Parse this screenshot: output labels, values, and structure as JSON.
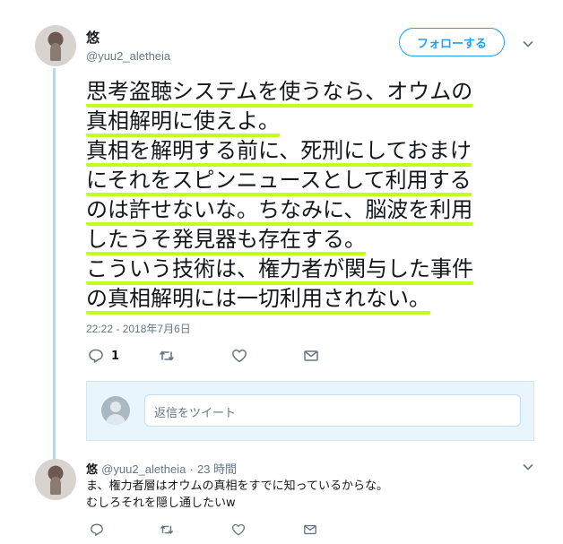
{
  "tweet": {
    "author_name": "悠",
    "author_handle": "@yuu2_aletheia",
    "follow_label": "フォローする",
    "lines": [
      "思考盗聴システムを使うなら、オウムの",
      "真相解明に使えよ。",
      "真相を解明する前に、死刑にしておまけ",
      "にそれをスピンニュースとして利用する",
      "のは許せないな。ちなみに、脳波を利用",
      "したうそ発見器も存在する。",
      "こういう技術は、権力者が関与した事件",
      "の真相解明には一切利用されない。"
    ],
    "timestamp": "22:22 - 2018年7月6日",
    "reply_count": "1"
  },
  "reply_box": {
    "placeholder": "返信をツイート"
  },
  "reply": {
    "author_name": "悠",
    "author_handle": "@yuu2_aletheia",
    "separator": "·",
    "time_ago": "23 時間",
    "lines": [
      "ま、権力者層はオウムの真相をすでに知っているからな。",
      "むしろそれを隠し通したいw"
    ]
  },
  "colors": {
    "accent": "#1da1f2",
    "highlight": "#c3ff1c",
    "thread_line": "#a6def9",
    "muted_text": "#657786"
  },
  "icons": {
    "reply": "reply-icon",
    "retweet": "retweet-icon",
    "like": "heart-icon",
    "dm": "envelope-icon",
    "menu": "chevron-down-icon"
  }
}
